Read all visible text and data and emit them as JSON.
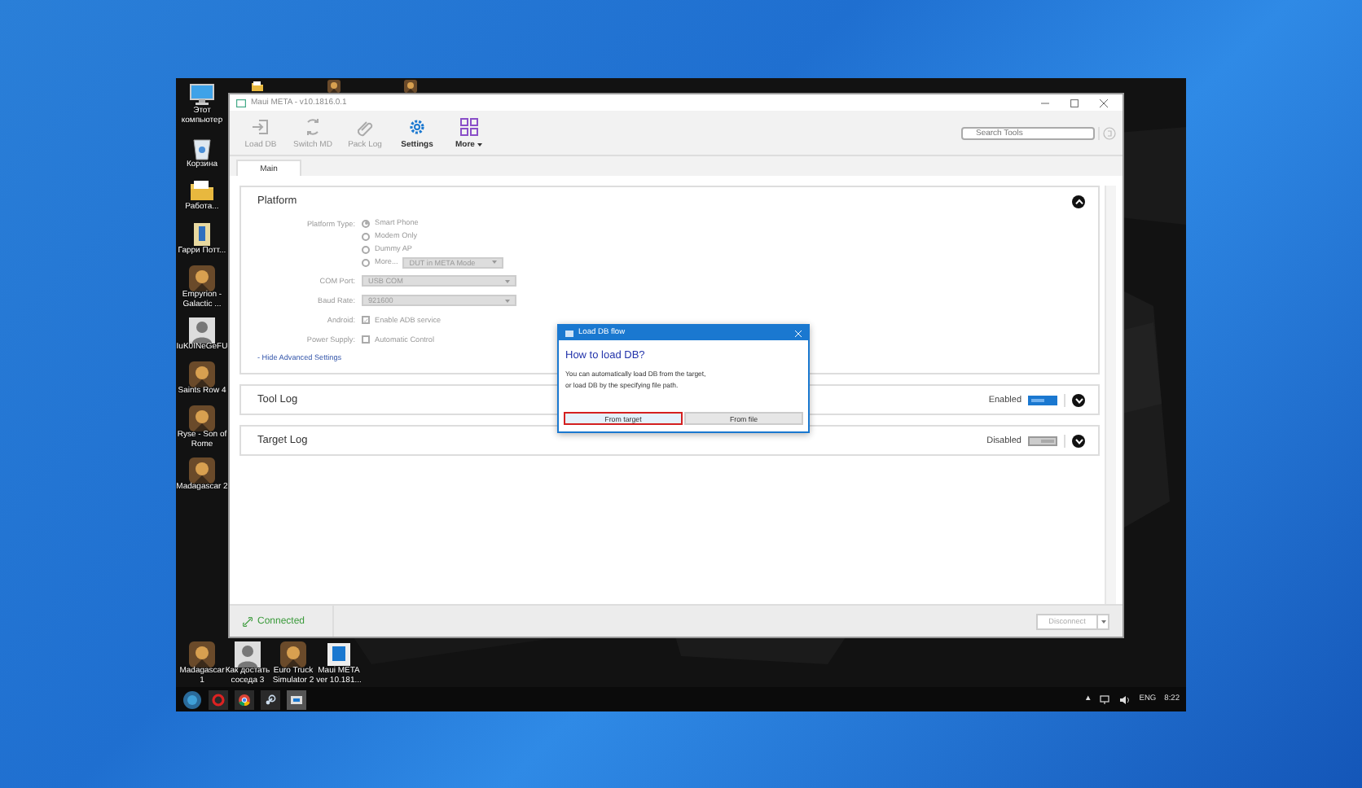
{
  "desktop": {
    "top_icons": [
      {
        "kind": "folder"
      },
      {
        "kind": "game"
      },
      {
        "kind": "game"
      }
    ],
    "icons": [
      {
        "label": "Этот компьютер",
        "kind": "computer"
      },
      {
        "label": "Корзина",
        "kind": "trash"
      },
      {
        "label": "Работа...",
        "kind": "folder"
      },
      {
        "label": "Гарри Потт...",
        "kind": "book"
      },
      {
        "label": "Empyrion - Galactic ...",
        "kind": "game"
      },
      {
        "label": "IuK0INeGeFU",
        "kind": "avatar"
      },
      {
        "label": "Saints Row 4",
        "kind": "game"
      },
      {
        "label": "Ryse - Son of Rome",
        "kind": "game"
      },
      {
        "label": "Madagascar 2",
        "kind": "game"
      }
    ],
    "bottom_icons": [
      {
        "label": "Madagascar 1",
        "kind": "game"
      },
      {
        "label": "Как достать соседа 3",
        "kind": "avatar"
      },
      {
        "label": "Euro Truck Simulator 2",
        "kind": "game"
      },
      {
        "label": "Maui META ver 10.181...",
        "kind": "app"
      }
    ]
  },
  "window": {
    "title": "Maui META - v10.1816.0.1",
    "toolbar": [
      {
        "label": "Load DB",
        "kind": "load",
        "disabled": true
      },
      {
        "label": "Switch MD",
        "kind": "switch",
        "disabled": true
      },
      {
        "label": "Pack Log",
        "kind": "clip",
        "disabled": true
      },
      {
        "label": "Settings",
        "kind": "gear",
        "disabled": false
      },
      {
        "label": "More",
        "kind": "grid",
        "disabled": false,
        "menu": true
      }
    ],
    "search": {
      "placeholder": "Search Tools"
    },
    "tabs": [
      {
        "label": "Main",
        "selected": true
      }
    ],
    "platform": {
      "title": "Platform",
      "expanded": true,
      "platform_type": {
        "label": "Platform Type:",
        "options": [
          {
            "label": "Smart Phone",
            "selected": true
          },
          {
            "label": "Modem Only",
            "selected": false
          },
          {
            "label": "Dummy AP",
            "selected": false
          },
          {
            "label": "More...",
            "selected": false,
            "select": "DUT in META Mode"
          }
        ]
      },
      "com_port": {
        "label": "COM Port:",
        "value": "USB COM"
      },
      "baud_rate": {
        "label": "Baud Rate:",
        "value": "921600"
      },
      "android": {
        "label": "Android:",
        "checkbox": "Enable ADB service",
        "checked": true
      },
      "power_supply": {
        "label": "Power Supply:",
        "checkbox": "Automatic Control",
        "checked": false
      },
      "advanced_link": "- Hide Advanced Settings"
    },
    "logs": [
      {
        "title": "Tool Log",
        "status": "Enabled",
        "on": true,
        "expanded": false
      },
      {
        "title": "Target Log",
        "status": "Disabled",
        "on": false,
        "expanded": false
      }
    ],
    "status": {
      "connection": "Connected",
      "button": "Disconnect"
    }
  },
  "dialog": {
    "title": "Load DB flow",
    "heading": "How to load DB?",
    "lines": [
      "You can automatically load DB from the target,",
      "or load DB by the specifying file path."
    ],
    "buttons": [
      {
        "label": "From target",
        "highlighted": true
      },
      {
        "label": "From file",
        "highlighted": false
      }
    ]
  },
  "taskbar": {
    "apps": [
      {
        "kind": "opera",
        "active": false
      },
      {
        "kind": "chrome",
        "active": false
      },
      {
        "kind": "steam",
        "active": false
      },
      {
        "kind": "window",
        "active": true
      }
    ],
    "tray": {
      "arrow": "▲",
      "language": "ENG",
      "time": "8:22"
    }
  }
}
